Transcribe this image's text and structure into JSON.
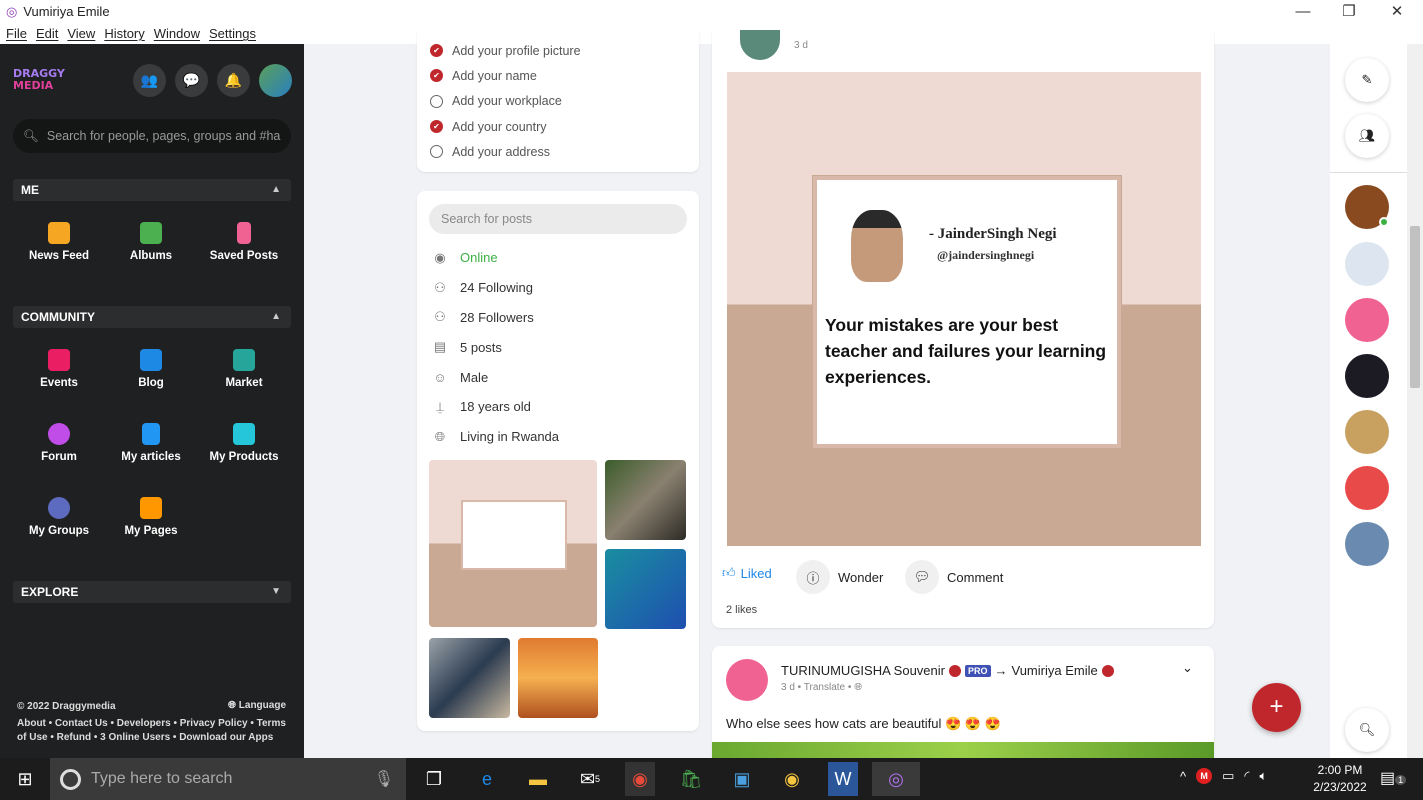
{
  "window": {
    "title": "Vumiriya Emile",
    "menu": [
      "File",
      "Edit",
      "View",
      "History",
      "Window",
      "Settings"
    ]
  },
  "sidebar": {
    "logo": "DRAGGY MEDIA",
    "search_placeholder": "Search for people, pages, groups and #ha",
    "me_label": "ME",
    "me_items": [
      {
        "label": "News Feed",
        "color": "#f5a623"
      },
      {
        "label": "Albums",
        "color": "#4caf50"
      },
      {
        "label": "Saved Posts",
        "color": "#f06292"
      }
    ],
    "community_label": "COMMUNITY",
    "community_items": [
      {
        "label": "Events",
        "color": "#e91e63"
      },
      {
        "label": "Blog",
        "color": "#1e88e5"
      },
      {
        "label": "Market",
        "color": "#26a69a"
      },
      {
        "label": "Forum",
        "color": "#c04de8"
      },
      {
        "label": "My articles",
        "color": "#2196f3"
      },
      {
        "label": "My Products",
        "color": "#26c6da"
      },
      {
        "label": "My Groups",
        "color": "#5c6bc0"
      },
      {
        "label": "My Pages",
        "color": "#ff9800"
      }
    ],
    "explore_label": "EXPLORE",
    "footer": {
      "copyright": "© 2022 Draggymedia",
      "language": "Language",
      "links": "About • Contact Us • Developers • Privacy Policy • Terms of Use • Refund • 3 Online Users • Download our Apps"
    }
  },
  "profile_checklist": [
    {
      "label": "Add your profile picture",
      "done": true
    },
    {
      "label": "Add your name",
      "done": true
    },
    {
      "label": "Add your workplace",
      "done": false
    },
    {
      "label": "Add your country",
      "done": true
    },
    {
      "label": "Add your address",
      "done": false
    }
  ],
  "about": {
    "search_placeholder": "Search for posts",
    "items": [
      {
        "icon": "eye-icon",
        "label": "Online"
      },
      {
        "icon": "user-plus-icon",
        "label": "24 Following"
      },
      {
        "icon": "users-icon",
        "label": "28 Followers"
      },
      {
        "icon": "document-icon",
        "label": "5 posts"
      },
      {
        "icon": "smile-icon",
        "label": "Male"
      },
      {
        "icon": "cake-icon",
        "label": "18 years old"
      },
      {
        "icon": "globe-icon",
        "label": "Living in Rwanda"
      }
    ],
    "online_color": "#3cb043"
  },
  "post1": {
    "time": "3 d",
    "quote_author": "- JainderSingh Negi",
    "quote_handle": "@jaindersinghnegi",
    "quote_text": "Your mistakes are your best teacher and failures your learning experiences.",
    "actions": {
      "liked": "Liked",
      "wonder": "Wonder",
      "comment": "Comment"
    },
    "likes": "2 likes"
  },
  "post2": {
    "author": "TURINUMUGISHA Souvenir",
    "badge": "PRO",
    "target": "Vumiriya Emile",
    "time": "3 d",
    "translate": "Translate",
    "text": "Who else sees how cats are beautiful",
    "emojis": "😍 😍 😍"
  },
  "taskbar": {
    "search_placeholder": "Type here to search",
    "time": "2:00 PM",
    "date": "2/23/2022",
    "notification_count": "1",
    "mail_count": "5"
  },
  "accent": "#c0272d"
}
